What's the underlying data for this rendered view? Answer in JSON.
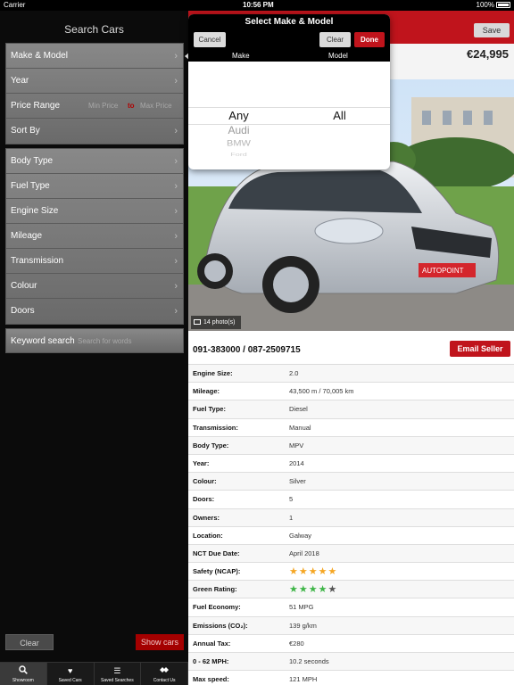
{
  "status_bar": {
    "carrier": "Carrier",
    "time": "10:56 PM",
    "battery": "100%"
  },
  "search": {
    "title": "Search Cars",
    "group1": [
      {
        "label": "Make & Model"
      },
      {
        "label": "Year"
      },
      {
        "label": "Price Range",
        "min_placeholder": "Min Price",
        "to": "to",
        "max_placeholder": "Max Price"
      },
      {
        "label": "Sort By"
      }
    ],
    "group2": [
      {
        "label": "Body Type"
      },
      {
        "label": "Fuel Type"
      },
      {
        "label": "Engine Size"
      },
      {
        "label": "Mileage"
      },
      {
        "label": "Transmission"
      },
      {
        "label": "Colour"
      },
      {
        "label": "Doors"
      }
    ],
    "keyword": {
      "label": "Keyword search",
      "placeholder": "Search for words"
    },
    "clear_label": "Clear",
    "show_label": "Show cars"
  },
  "tabs": [
    {
      "label": "Showroom",
      "icon": "search-icon",
      "active": true
    },
    {
      "label": "Saved Cars",
      "icon": "heart-icon",
      "active": false
    },
    {
      "label": "Saved Searches",
      "icon": "list-icon",
      "active": false
    },
    {
      "label": "Contact Us",
      "icon": "handshake-icon",
      "active": false
    }
  ],
  "detail": {
    "save_label": "Save",
    "price": "€24,995",
    "photo_count": "14 photo(s)",
    "phones": "091-383000 / 087-2509715",
    "email_label": "Email Seller",
    "specs": [
      {
        "label": "Engine Size:",
        "value": "2.0"
      },
      {
        "label": "Mileage:",
        "value": "43,500 m / 70,005 km"
      },
      {
        "label": "Fuel Type:",
        "value": "Diesel"
      },
      {
        "label": "Transmission:",
        "value": "Manual"
      },
      {
        "label": "Body Type:",
        "value": "MPV"
      },
      {
        "label": "Year:",
        "value": "2014"
      },
      {
        "label": "Colour:",
        "value": "Silver"
      },
      {
        "label": "Doors:",
        "value": "5"
      },
      {
        "label": "Owners:",
        "value": "1"
      },
      {
        "label": "Location:",
        "value": "Galway"
      },
      {
        "label": "NCT Due Date:",
        "value": "April 2018"
      },
      {
        "label": "Safety (NCAP):",
        "stars": 5,
        "max": 5,
        "color": "#f5a623"
      },
      {
        "label": "Green Rating:",
        "stars": 4,
        "max": 5,
        "color": "#3fb548"
      },
      {
        "label": "Fuel Economy:",
        "value": "51 MPG"
      },
      {
        "label": "Emissions (CO₂):",
        "value": "139 g/km"
      },
      {
        "label": "Annual Tax:",
        "value": "€280"
      },
      {
        "label": "0 - 62 MPH:",
        "value": "10.2 seconds"
      },
      {
        "label": "Max speed:",
        "value": "121 MPH"
      }
    ]
  },
  "picker": {
    "title": "Select Make & Model",
    "cancel_label": "Cancel",
    "clear_label": "Clear",
    "done_label": "Done",
    "make_header": "Make",
    "model_header": "Model",
    "make_selected": "Any",
    "make_options": [
      "Audi",
      "BMW",
      "Ford"
    ],
    "model_selected": "All"
  },
  "colors": {
    "brand_red": "#c0141c",
    "panel_grey": "#7a7a7a"
  }
}
